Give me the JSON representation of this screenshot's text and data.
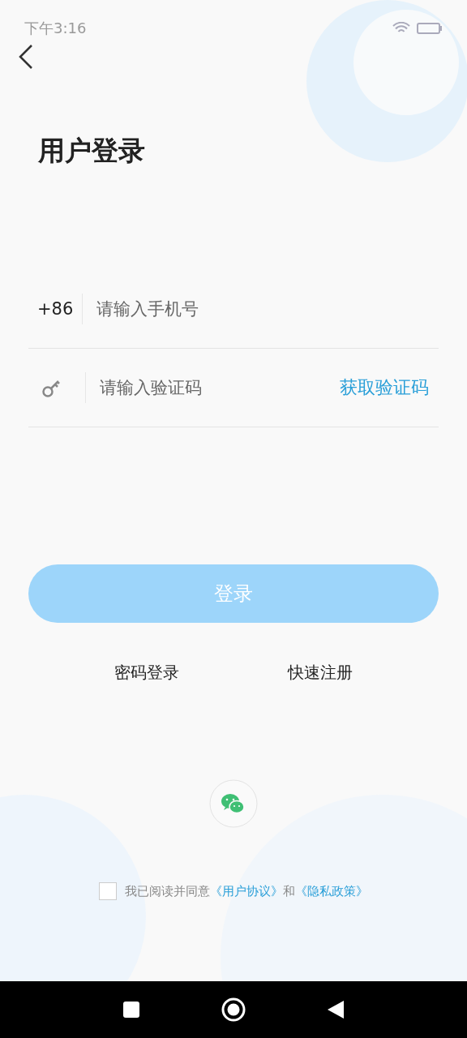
{
  "status_bar": {
    "time": "下午3:16"
  },
  "title": "用户登录",
  "phone_field": {
    "country_code": "+86",
    "placeholder": "请输入手机号"
  },
  "code_field": {
    "placeholder": "请输入验证码",
    "get_code": "获取验证码"
  },
  "login_button": {
    "label": "登录",
    "disabled": true
  },
  "links": [
    "密码登录",
    "快速注册"
  ],
  "agreement": {
    "checked": false,
    "prefix": "我已阅读并同意",
    "terms": "《用户协议》",
    "and": "和",
    "privacy": "《隐私政策》"
  }
}
